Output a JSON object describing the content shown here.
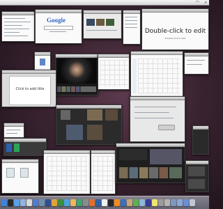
{
  "menubar": {
    "wifi_icon": "wifi-icon",
    "spotlight_icon": "spotlight-icon"
  },
  "google_window": {
    "logo": "Google"
  },
  "pages_window": {
    "title": "Double-click to edit",
    "subtitle": "Double-click to edit"
  },
  "keynote_window": {
    "slide_title": "Click to add title"
  },
  "dock": {
    "icons": [
      "finder-icon",
      "dashboard-icon",
      "safari-icon",
      "mail-icon",
      "ical-icon",
      "itunes-icon",
      "iphoto-icon",
      "imovie-icon",
      "garageband-icon",
      "iweb-icon",
      "keynote-icon",
      "pages-icon",
      "numbers-icon",
      "preferences-icon",
      "firefox-icon",
      "photoshop-icon",
      "textedit-icon",
      "terminal-icon",
      "vlc-icon",
      "xcode-icon",
      "address-book-icon",
      "ichat-icon",
      "preview-icon",
      "quicktime-icon",
      "stickies-icon",
      "calculator-icon",
      "automator-icon",
      "utilities-icon",
      "downloads-icon",
      "documents-icon",
      "trash-icon"
    ],
    "colors": [
      "#3f83d9",
      "#2a2a2a",
      "#5aa0e6",
      "#8fb5e0",
      "#d8d8d8",
      "#4c7cd4",
      "#6e8fb0",
      "#2f4f8f",
      "#e0a23b",
      "#3e8c3e",
      "#4aa3df",
      "#e9b85b",
      "#39a86a",
      "#8b8b8b",
      "#e56d2a",
      "#2f5fa5",
      "#f0f0f0",
      "#262626",
      "#f28b1e",
      "#3a6fbd",
      "#c7a676",
      "#5fb053",
      "#8db7d8",
      "#3b3b9a",
      "#f1e36b",
      "#9b9b9b",
      "#b4b4b4",
      "#7c98c0",
      "#8aa8d6",
      "#6b8fd4",
      "#c3c8cf"
    ]
  }
}
